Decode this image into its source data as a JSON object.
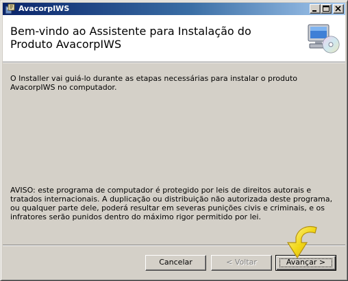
{
  "window": {
    "title": "AvacorpIWS"
  },
  "titlebar": {
    "icons": [
      "installer-app-icon",
      "minimize-icon",
      "maximize-icon",
      "close-icon"
    ]
  },
  "header": {
    "title": "Bem-vindo ao Assistente para Instalação do Produto AvacorpIWS",
    "icon": "computer-cd-icon"
  },
  "body": {
    "intro": "O Installer vai guiá-lo durante as etapas necessárias para instalar o produto AvacorpIWS no computador.",
    "warning": "AVISO: este programa de computador é protegido por leis de direitos autorais e tratados internacionais. A duplicação ou distribuição não autorizada deste programa, ou qualquer parte dele, poderá resultar em severas punições civis e criminais, e os infratores serão punidos dentro do máximo rigor permitido por lei."
  },
  "footer": {
    "cancel_label": "Cancelar",
    "back_label": "< Voltar",
    "next_label": "Avançar >",
    "back_enabled": false,
    "highlight_icon": "curved-arrow-pointer-icon"
  },
  "colors": {
    "titlebar_start": "#0a246a",
    "titlebar_end": "#a6caf0",
    "window_face": "#d4d0c8",
    "header_bg": "#ffffff",
    "arrow_yellow": "#f5d90a"
  }
}
